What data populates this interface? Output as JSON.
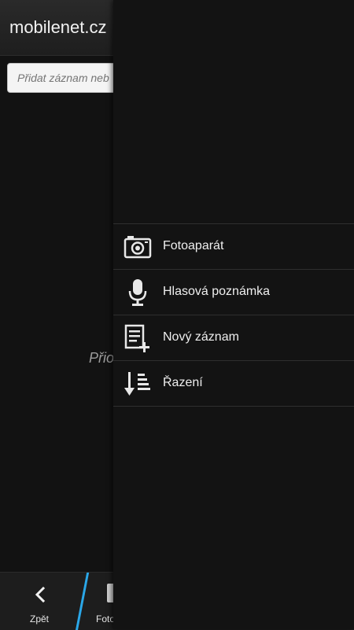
{
  "header": {
    "title": "mobilenet.cz"
  },
  "search": {
    "placeholder": "Přidat záznam neb"
  },
  "empty_state": {
    "text": "Přio"
  },
  "action_bar": {
    "back_label": "Zpět",
    "camera_label": "Foto"
  },
  "menu": {
    "items": [
      {
        "label": "Fotoaparát",
        "icon": "camera-icon"
      },
      {
        "label": "Hlasová poznámka",
        "icon": "microphone-icon"
      },
      {
        "label": "Nový záznam",
        "icon": "new-note-icon"
      },
      {
        "label": "Řazení",
        "icon": "sort-icon"
      }
    ]
  },
  "colors": {
    "background": "#121212",
    "menu_background": "#131313",
    "accent": "#2aa7e8",
    "divider": "#2f2f2f"
  }
}
